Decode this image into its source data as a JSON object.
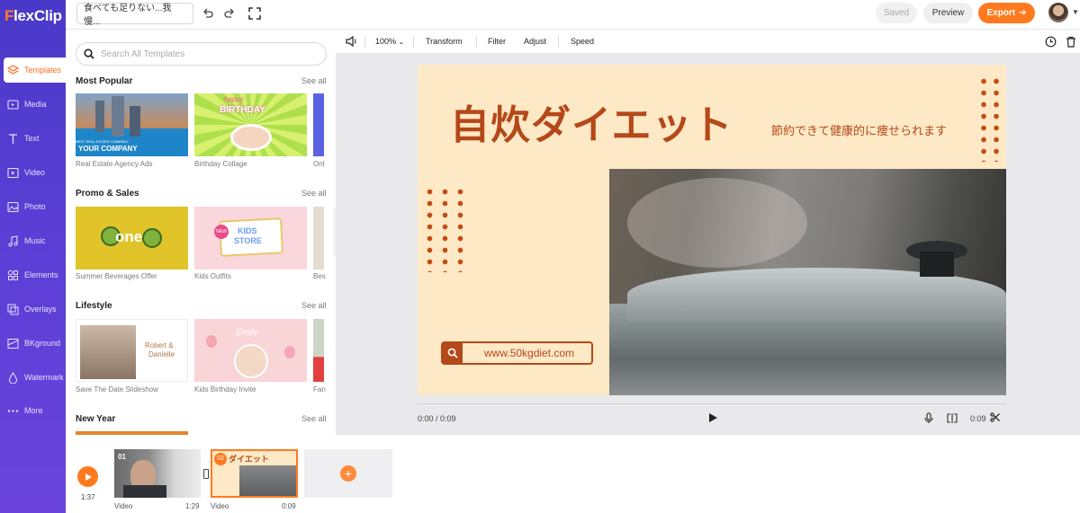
{
  "app": {
    "logo_f": "F",
    "logo_rest": "lexClip"
  },
  "nav": {
    "items": [
      {
        "label": "Templates",
        "icon": "layers-icon"
      },
      {
        "label": "Media",
        "icon": "media-icon"
      },
      {
        "label": "Text",
        "icon": "text-icon"
      },
      {
        "label": "Video",
        "icon": "video-icon"
      },
      {
        "label": "Photo",
        "icon": "photo-icon"
      },
      {
        "label": "Music",
        "icon": "music-icon"
      },
      {
        "label": "Elements",
        "icon": "elements-icon"
      },
      {
        "label": "Overlays",
        "icon": "overlays-icon"
      },
      {
        "label": "BKground",
        "icon": "background-icon"
      },
      {
        "label": "Watermark",
        "icon": "watermark-icon"
      },
      {
        "label": "More",
        "icon": "more-icon"
      }
    ]
  },
  "topbar": {
    "project_title": "食べても足りない...我慢...",
    "saved": "Saved",
    "preview": "Preview",
    "export": "Export"
  },
  "panel": {
    "search_placeholder": "Search All Templates",
    "see_all": "See all",
    "sections": [
      {
        "title": "Most Popular",
        "items": [
          "Real Estate Agency Ads",
          "Birthday Collage",
          "Onl"
        ]
      },
      {
        "title": "Promo & Sales",
        "items": [
          "Summer Beverages Offer",
          "Kids Outfits",
          "Bes"
        ]
      },
      {
        "title": "Lifestyle",
        "items": [
          "Save The Date Slideshow",
          "Kids Birthday Invite",
          "Fan"
        ]
      },
      {
        "title": "New Year",
        "items": []
      }
    ],
    "thumb_text": {
      "realestate_small": "BEST REAL ESTATE COMPANY",
      "realestate_big": "YOUR COMPANY",
      "birthday_happy": "happy",
      "birthday_big": "BIRTHDAY",
      "one": "one",
      "kids1": "KIDS",
      "kids2": "STORE",
      "kids_new": "NEW",
      "robert": "Robert &",
      "danielle": "Danielle",
      "emily": "Emily"
    }
  },
  "toolbar": {
    "zoom": "100%",
    "transform": "Transform",
    "filter": "Filter",
    "adjust": "Adjust",
    "speed": "Speed"
  },
  "canvas": {
    "title": "自炊ダイエット",
    "subtitle": "節約できて健康的に痩せられます",
    "url": "www.50kgdiet.com",
    "bg_color": "#fde9c6",
    "accent_color": "#b5481a"
  },
  "player": {
    "current_time": "0:00 / 0:09",
    "end_time": "0:09"
  },
  "timeline": {
    "total_duration": "1:37",
    "clips": [
      {
        "number": "01",
        "type": "Video",
        "duration": "1:29"
      },
      {
        "number": "02",
        "type": "Video",
        "duration": "0:09",
        "overlay_text": "ダイエット"
      }
    ]
  }
}
